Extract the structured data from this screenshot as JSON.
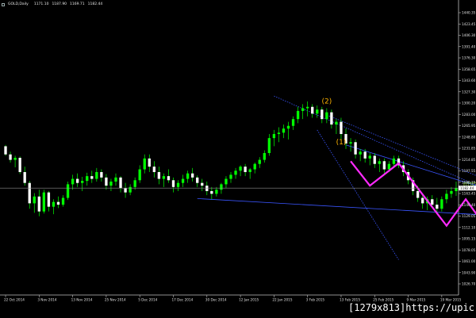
{
  "header": {
    "symbol": "GOLD,Daily",
    "ohlc": [
      "1171.10",
      "1187.90",
      "1169.71",
      "1182.44"
    ]
  },
  "watermark": "[1279x813]https://upic.me/",
  "colors": {
    "background": "#000000",
    "bull_body": "#00ff00",
    "bear_body": "#ffffff",
    "wick": "#00ff00",
    "trendline": "#3a55ff",
    "projection": "#ff2aff",
    "wave_label": "#ffb400",
    "price_marker": "#9aff3a"
  },
  "chart_data": {
    "type": "candlestick",
    "x_tick_labels": [
      "22 Oct 2014",
      "3 Nov 2014",
      "13 Nov 2014",
      "25 Nov 2014",
      "5 Dec 2014",
      "17 Dec 2014",
      "30 Dec 2014",
      "12 Jan 2015",
      "22 Jan 2015",
      "3 Feb 2015",
      "13 Feb 2015",
      "25 Feb 2015",
      "9 Mar 2015",
      "19 Mar 2015"
    ],
    "y_tick_labels": [
      "1440.35",
      "1423.45",
      "1406.30",
      "1391.40",
      "1376.30",
      "1358.65",
      "1343.60",
      "1327.30",
      "1300.20",
      "1283.00",
      "1265.95",
      "1248.80",
      "1231.85",
      "1214.85",
      "1197.55",
      "1180.15",
      "1163.45",
      "1146.40",
      "1129.05",
      "1112.10",
      "1095.15",
      "1078.05",
      "1061.00",
      "1043.90",
      "1026.70"
    ],
    "ylim": [
      1025,
      1450
    ],
    "current_price": "1182.44",
    "price_marker_label": "1174.44",
    "wave_labels": [
      {
        "text": "(2)",
        "candle": 67,
        "price": 1307
      },
      {
        "text": "(1)",
        "candle": 70,
        "price": 1247
      }
    ],
    "candles": [
      [
        1244,
        1246,
        1230,
        1232
      ],
      [
        1232,
        1236,
        1220,
        1224
      ],
      [
        1224,
        1230,
        1213,
        1227
      ],
      [
        1227,
        1229,
        1203,
        1206
      ],
      [
        1206,
        1214,
        1186,
        1190
      ],
      [
        1190,
        1193,
        1152,
        1160
      ],
      [
        1160,
        1175,
        1146,
        1170
      ],
      [
        1170,
        1180,
        1141,
        1148
      ],
      [
        1148,
        1180,
        1145,
        1176
      ],
      [
        1176,
        1178,
        1148,
        1155
      ],
      [
        1155,
        1166,
        1144,
        1162
      ],
      [
        1162,
        1170,
        1153,
        1158
      ],
      [
        1158,
        1172,
        1155,
        1168
      ],
      [
        1168,
        1192,
        1165,
        1188
      ],
      [
        1188,
        1202,
        1180,
        1196
      ],
      [
        1196,
        1204,
        1184,
        1190
      ],
      [
        1190,
        1199,
        1178,
        1193
      ],
      [
        1193,
        1205,
        1186,
        1200
      ],
      [
        1200,
        1208,
        1190,
        1196
      ],
      [
        1196,
        1212,
        1192,
        1206
      ],
      [
        1206,
        1210,
        1192,
        1198
      ],
      [
        1198,
        1203,
        1180,
        1186
      ],
      [
        1186,
        1196,
        1178,
        1192
      ],
      [
        1192,
        1204,
        1186,
        1198
      ],
      [
        1198,
        1200,
        1176,
        1182
      ],
      [
        1182,
        1190,
        1168,
        1176
      ],
      [
        1176,
        1188,
        1172,
        1184
      ],
      [
        1184,
        1198,
        1180,
        1194
      ],
      [
        1194,
        1216,
        1190,
        1210
      ],
      [
        1210,
        1232,
        1204,
        1226
      ],
      [
        1226,
        1232,
        1206,
        1214
      ],
      [
        1214,
        1222,
        1198,
        1206
      ],
      [
        1206,
        1214,
        1188,
        1196
      ],
      [
        1196,
        1204,
        1184,
        1200
      ],
      [
        1200,
        1210,
        1190,
        1194
      ],
      [
        1194,
        1198,
        1176,
        1184
      ],
      [
        1184,
        1194,
        1178,
        1190
      ],
      [
        1190,
        1202,
        1184,
        1196
      ],
      [
        1196,
        1208,
        1190,
        1204
      ],
      [
        1204,
        1212,
        1192,
        1198
      ],
      [
        1198,
        1201,
        1184,
        1190
      ],
      [
        1190,
        1196,
        1178,
        1186
      ],
      [
        1186,
        1192,
        1172,
        1178
      ],
      [
        1178,
        1184,
        1166,
        1174
      ],
      [
        1174,
        1184,
        1170,
        1180
      ],
      [
        1180,
        1190,
        1174,
        1188
      ],
      [
        1188,
        1200,
        1182,
        1196
      ],
      [
        1196,
        1206,
        1190,
        1202
      ],
      [
        1202,
        1212,
        1196,
        1208
      ],
      [
        1208,
        1216,
        1200,
        1214
      ],
      [
        1214,
        1218,
        1200,
        1206
      ],
      [
        1206,
        1212,
        1196,
        1210
      ],
      [
        1210,
        1220,
        1204,
        1218
      ],
      [
        1218,
        1228,
        1212,
        1224
      ],
      [
        1224,
        1238,
        1220,
        1234
      ],
      [
        1234,
        1262,
        1230,
        1256
      ],
      [
        1256,
        1268,
        1244,
        1262
      ],
      [
        1262,
        1272,
        1250,
        1264
      ],
      [
        1264,
        1276,
        1256,
        1270
      ],
      [
        1270,
        1280,
        1254,
        1274
      ],
      [
        1274,
        1288,
        1268,
        1284
      ],
      [
        1284,
        1302,
        1278,
        1296
      ],
      [
        1296,
        1306,
        1284,
        1300
      ],
      [
        1300,
        1310,
        1288,
        1302
      ],
      [
        1302,
        1306,
        1286,
        1292
      ],
      [
        1292,
        1304,
        1286,
        1298
      ],
      [
        1298,
        1302,
        1278,
        1284
      ],
      [
        1284,
        1300,
        1278,
        1294
      ],
      [
        1294,
        1298,
        1270,
        1276
      ],
      [
        1276,
        1284,
        1262,
        1280
      ],
      [
        1280,
        1286,
        1254,
        1262
      ],
      [
        1262,
        1270,
        1240,
        1248
      ],
      [
        1248,
        1256,
        1236,
        1250
      ],
      [
        1250,
        1254,
        1226,
        1232
      ],
      [
        1232,
        1240,
        1222,
        1236
      ],
      [
        1236,
        1240,
        1220,
        1226
      ],
      [
        1226,
        1234,
        1216,
        1230
      ],
      [
        1230,
        1234,
        1212,
        1218
      ],
      [
        1218,
        1226,
        1206,
        1222
      ],
      [
        1222,
        1226,
        1204,
        1210
      ],
      [
        1210,
        1222,
        1206,
        1218
      ],
      [
        1218,
        1230,
        1214,
        1226
      ],
      [
        1226,
        1230,
        1212,
        1216
      ],
      [
        1216,
        1222,
        1200,
        1206
      ],
      [
        1206,
        1210,
        1188,
        1194
      ],
      [
        1194,
        1198,
        1172,
        1178
      ],
      [
        1178,
        1186,
        1162,
        1168
      ],
      [
        1168,
        1172,
        1152,
        1160
      ],
      [
        1160,
        1170,
        1150,
        1166
      ],
      [
        1166,
        1172,
        1154,
        1158
      ],
      [
        1158,
        1168,
        1146,
        1152
      ],
      [
        1152,
        1170,
        1148,
        1166
      ],
      [
        1166,
        1180,
        1160,
        1174
      ],
      [
        1174,
        1184,
        1168,
        1178
      ],
      [
        1178,
        1192,
        1171,
        1182
      ]
    ],
    "trend_lines": [
      {
        "name": "channel-upper",
        "style": "solid",
        "from": [
          71,
          1246
        ],
        "to": [
          100,
          1182
        ]
      },
      {
        "name": "channel-lower",
        "style": "solid",
        "from": [
          40,
          1167
        ],
        "to": [
          112,
          1138
        ]
      },
      {
        "name": "wave-line-a",
        "style": "dotted",
        "from": [
          56,
          1318
        ],
        "to": [
          101,
          1178
        ]
      },
      {
        "name": "wave-line-b",
        "style": "dotted",
        "from": [
          67,
          1290
        ],
        "to": [
          103,
          1187
        ]
      },
      {
        "name": "wave-line-c",
        "style": "dotted",
        "from": [
          65,
          1268
        ],
        "to": [
          82,
          1077
        ]
      }
    ],
    "projection": [
      [
        72,
        1222
      ],
      [
        76,
        1186
      ],
      [
        82,
        1219
      ],
      [
        92,
        1127
      ],
      [
        96,
        1166
      ],
      [
        100,
        1127
      ],
      [
        110,
        1218
      ]
    ]
  }
}
